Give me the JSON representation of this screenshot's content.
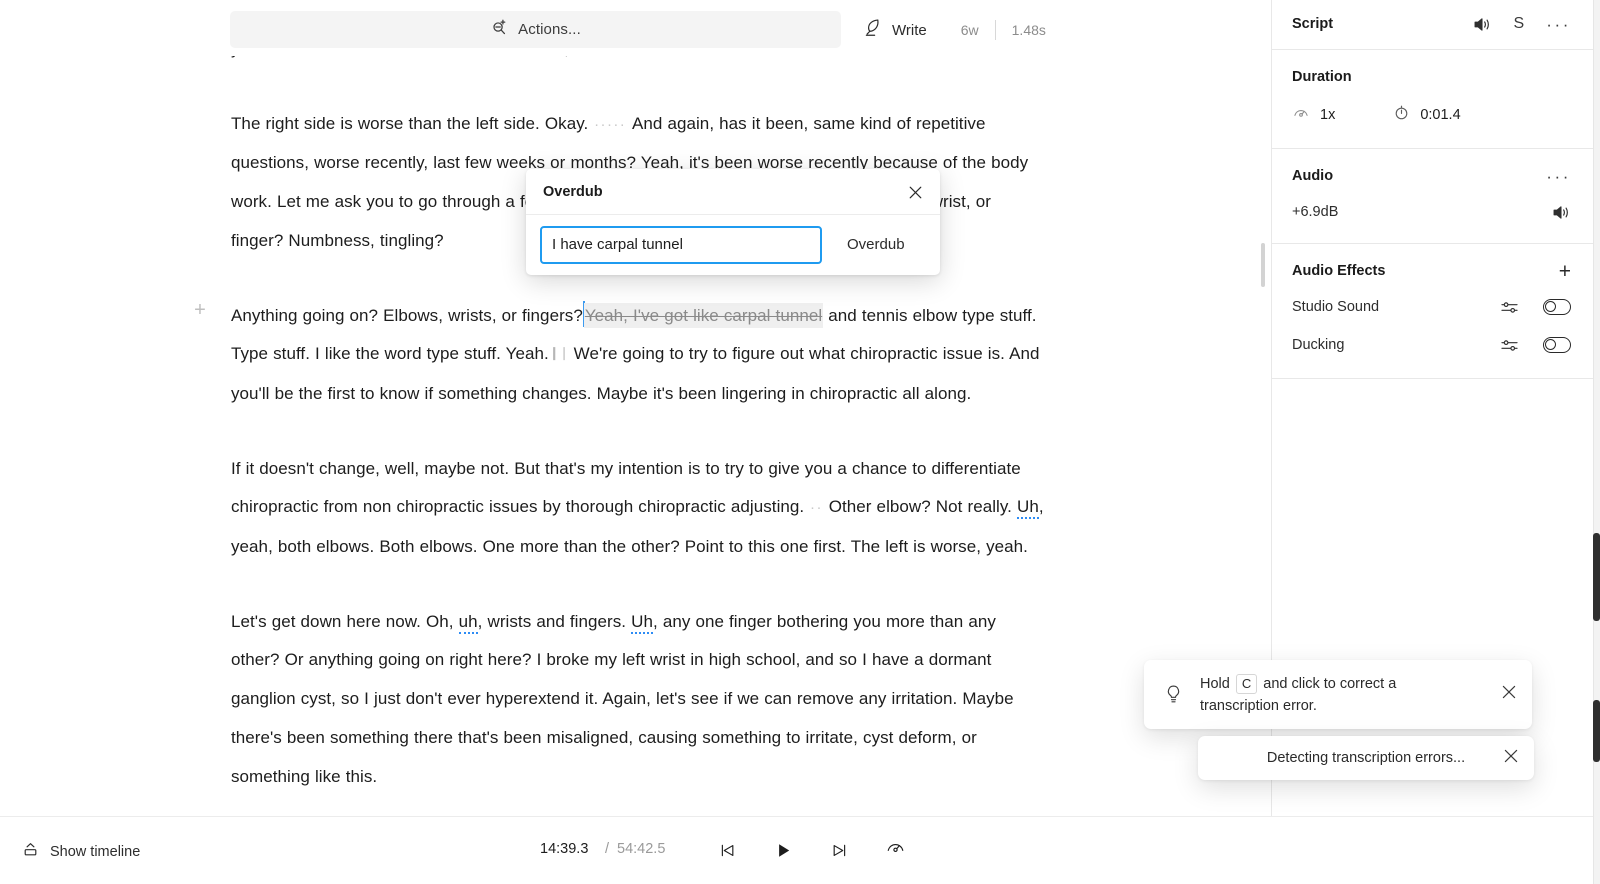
{
  "toolbar": {
    "actions_label": "Actions...",
    "actions_icon": "magnifier-plus-icon",
    "write_label": "Write",
    "write_icon": "feather-quill-icon",
    "word_count": "6w",
    "duration": "1.48s"
  },
  "transcript": {
    "paragraphs": [
      {
        "id": "p-cut-top",
        "clipped": true,
        "runs": [
          {
            "type": "text",
            "text": "you think one side is different than the other, or more or less?"
          }
        ]
      },
      {
        "id": "p-right-side",
        "runs": [
          {
            "type": "text",
            "text": "The right side is worse than the left side. Okay."
          },
          {
            "type": "gap",
            "text": "·····"
          },
          {
            "type": "text",
            "text": "And again, has it been, same kind of repetitive questions, worse recently, last few weeks or months? Yeah, it's been worse recently because of the body work. Let me ask you to go through a few more things. Any numbness going into the elbow, wrist, or finger? Numbness, tingling?"
          }
        ]
      },
      {
        "id": "p-anything-going-on",
        "has_plus_handle": true,
        "runs": [
          {
            "type": "text",
            "text": "Anything going on? Elbows, wrists, or fingers?"
          },
          {
            "type": "caret"
          },
          {
            "type": "struck",
            "text": "Yeah, I've got like carpal tunnel"
          },
          {
            "type": "text",
            "text": " and tennis elbow type stuff. Type stuff. I like the word type stuff. Yeah."
          },
          {
            "type": "pipe"
          },
          {
            "type": "text",
            "text": " We're going to try to figure out what chiropractic issue is. And you'll be the first to know if something changes. Maybe it's been lingering in chiropractic all along."
          }
        ]
      },
      {
        "id": "p-if-it-doesnt-change",
        "runs": [
          {
            "type": "text",
            "text": "If it doesn't change, well, maybe not. But that's my intention is to try to give you a chance to differentiate chiropractic from non chiropractic issues by thorough chiropractic adjusting."
          },
          {
            "type": "gap",
            "text": "··"
          },
          {
            "type": "text",
            "text": "Other elbow? Not really. "
          },
          {
            "type": "filler",
            "text": "Uh"
          },
          {
            "type": "text",
            "text": ", yeah, both elbows. Both elbows. One more than the other? Point to this one first. The left is worse, yeah."
          }
        ]
      },
      {
        "id": "p-lets-get-down",
        "runs": [
          {
            "type": "text",
            "text": "Let's get down here now. Oh, "
          },
          {
            "type": "filler",
            "text": "uh"
          },
          {
            "type": "text",
            "text": ", wrists and fingers. "
          },
          {
            "type": "filler",
            "text": "Uh"
          },
          {
            "type": "text",
            "text": ", any one finger bothering you more than any other? Or anything going on right here? I broke my left wrist in high school, and so I have a dormant ganglion cyst, so I just don't ever hyperextend it. Again, let's see if we can remove any irritation. Maybe there's been something there that's been misaligned, causing something to irritate, cyst deform, or something like this."
          }
        ]
      }
    ]
  },
  "overdub_dialog": {
    "title": "Overdub",
    "close_icon": "close-icon",
    "input_value": "I have carpal tunnel",
    "input_placeholder": "",
    "submit_label": "Overdub"
  },
  "sidebar": {
    "script": {
      "title": "Script",
      "volume_icon": "speaker-volume-icon",
      "solo_label": "S",
      "more_icon": "more-horizontal-icon"
    },
    "duration": {
      "title": "Duration",
      "speed_icon": "speed-gauge-icon",
      "speed_value": "1x",
      "time_icon": "stopwatch-icon",
      "time_value": "0:01.4"
    },
    "audio": {
      "title": "Audio",
      "more_icon": "more-horizontal-icon",
      "gain_value": "+6.9dB",
      "volume_icon": "speaker-volume-icon"
    },
    "audio_effects": {
      "title": "Audio Effects",
      "add_icon": "plus-icon",
      "effects": [
        {
          "label": "Studio Sound",
          "settings_icon": "sliders-icon",
          "toggle_icon": "toggle-off",
          "enabled": false
        },
        {
          "label": "Ducking",
          "settings_icon": "sliders-icon",
          "toggle_icon": "toggle-off",
          "enabled": false
        }
      ]
    }
  },
  "toasts": {
    "tip": {
      "icon": "lightbulb-icon",
      "prefix": "Hold",
      "key": "C",
      "suffix": "and click to correct a transcription error.",
      "close_icon": "close-icon"
    },
    "detecting": {
      "text": "Detecting transcription errors...",
      "close_icon": "close-icon"
    }
  },
  "bottom_bar": {
    "show_timeline_label": "Show timeline",
    "show_timeline_icon": "timeline-expand-icon",
    "current_time": "14:39.3",
    "separator": "/",
    "total_time": "54:42.5",
    "skip_back_icon": "skip-back-icon",
    "play_icon": "play-icon",
    "skip_forward_icon": "skip-forward-icon",
    "speed_icon": "speed-gauge-icon"
  },
  "colors": {
    "accent_blue": "#1f9bf0",
    "filler_underline": "#2d8cf5",
    "struck_text": "#8a8a8a",
    "struck_bg": "#efefef",
    "toolbar_bg": "#f4f4f4"
  }
}
